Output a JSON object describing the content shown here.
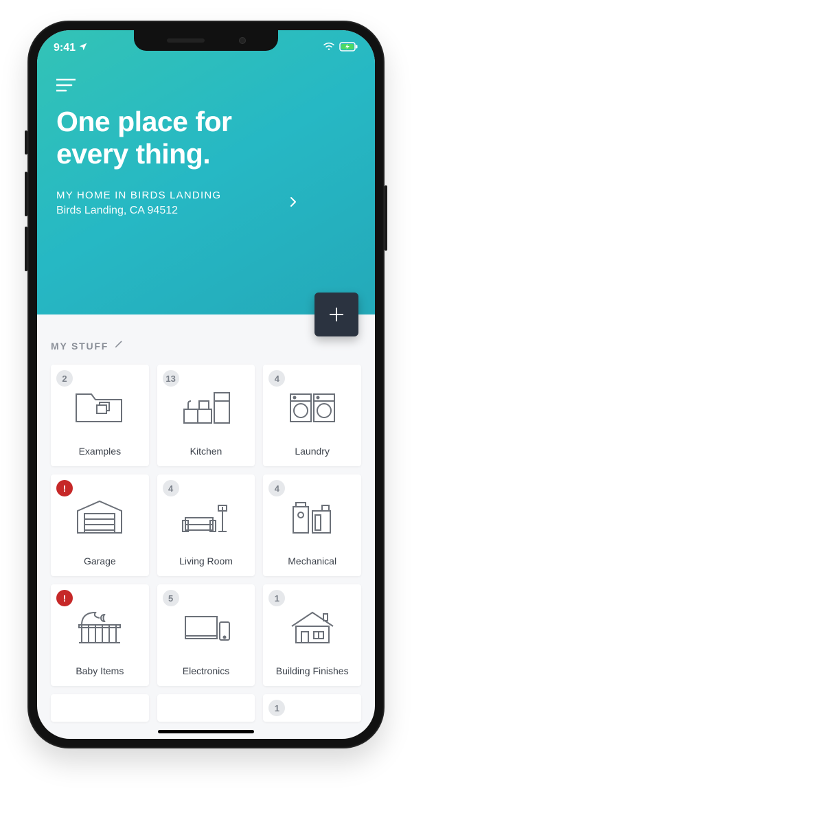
{
  "status": {
    "time": "9:41",
    "location_icon": "location-arrow",
    "wifi_icon": "wifi",
    "battery_icon": "battery-charging"
  },
  "header": {
    "menu_icon": "hamburger",
    "headline_line1": "One place for",
    "headline_line2": "every thing.",
    "home_label": "MY HOME IN BIRDS LANDING",
    "home_sub": "Birds Landing, CA 94512",
    "chevron_icon": "chevron-right",
    "add_icon": "plus"
  },
  "section": {
    "title": "MY STUFF",
    "edit_icon": "pencil"
  },
  "cards": [
    {
      "badge": "2",
      "alert": false,
      "label": "Examples",
      "icon": "folder"
    },
    {
      "badge": "13",
      "alert": false,
      "label": "Kitchen",
      "icon": "kitchen"
    },
    {
      "badge": "4",
      "alert": false,
      "label": "Laundry",
      "icon": "laundry"
    },
    {
      "badge": "!",
      "alert": true,
      "label": "Garage",
      "icon": "garage"
    },
    {
      "badge": "4",
      "alert": false,
      "label": "Living Room",
      "icon": "livingroom"
    },
    {
      "badge": "4",
      "alert": false,
      "label": "Mechanical",
      "icon": "mechanical"
    },
    {
      "badge": "!",
      "alert": true,
      "label": "Baby Items",
      "icon": "baby"
    },
    {
      "badge": "5",
      "alert": false,
      "label": "Electronics",
      "icon": "electronics"
    },
    {
      "badge": "1",
      "alert": false,
      "label": "Building Finishes",
      "icon": "house"
    }
  ],
  "partial": [
    {
      "badge": "",
      "alert": false
    },
    {
      "badge": "",
      "alert": false
    },
    {
      "badge": "1",
      "alert": false
    }
  ]
}
